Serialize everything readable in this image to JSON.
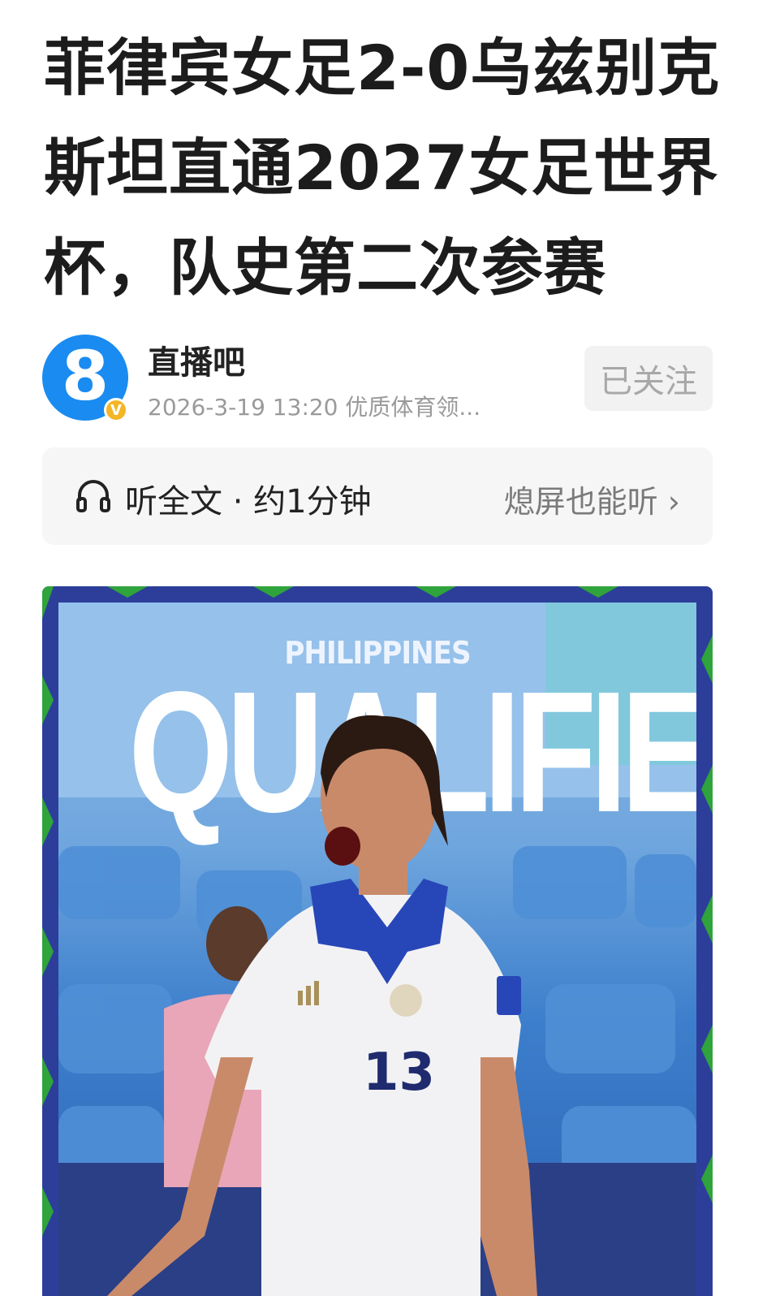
{
  "article": {
    "title": "菲律宾女足2-0乌兹别克斯坦直通2027女足世界杯，队史第二次参赛"
  },
  "author": {
    "avatar_text": "8",
    "verify_badge": "V",
    "name": "直播吧",
    "meta": "2026-3-19  13:20  优质体育领...",
    "follow_label": "已关注"
  },
  "listen": {
    "label": "听全文 · 约1分钟",
    "screenoff_label": "熄屏也能听 ›"
  },
  "image": {
    "headline_small": "PHILIPPINES",
    "headline_big": "QUALIFIED",
    "jersey_number": "13",
    "colors": {
      "border": "#2d3e9a",
      "border_accent": "#2fa33c",
      "sky": "#8bb9e6",
      "seats": "#2b62b3"
    }
  },
  "icons": {
    "headphone": "headphone-icon",
    "verified": "verified-badge-icon"
  }
}
